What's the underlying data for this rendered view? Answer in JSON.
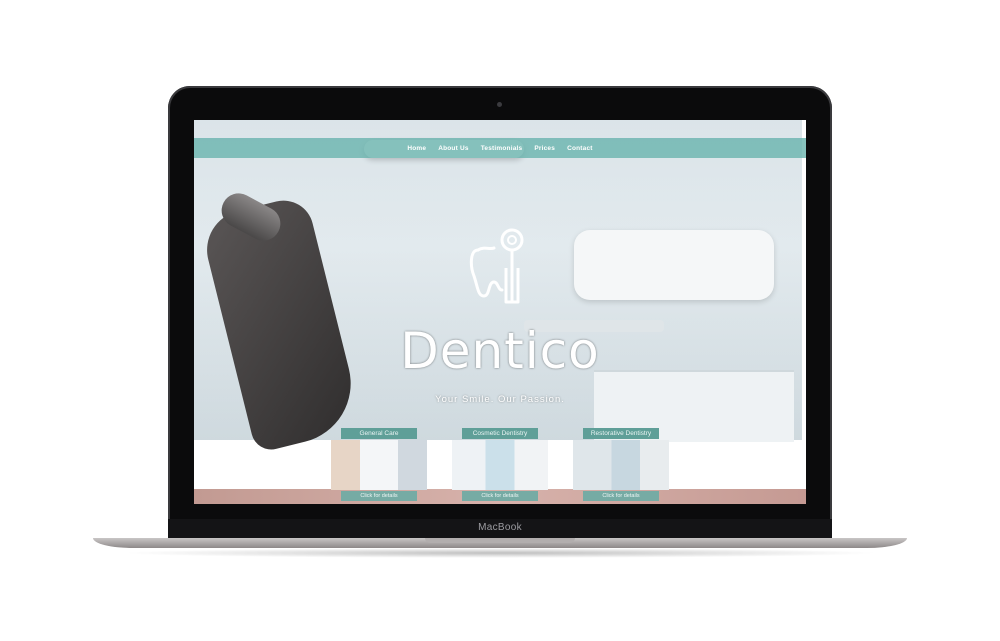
{
  "device": {
    "label": "MacBook"
  },
  "site": {
    "nav": [
      "Home",
      "About Us",
      "Testimonials",
      "Prices",
      "Contact"
    ],
    "brand": "Dentico",
    "tagline": "Your Smile. Our Passion.",
    "services": [
      {
        "title": "General Care",
        "action": "Click for details",
        "icon": "patient-photo"
      },
      {
        "title": "Cosmetic Dentistry",
        "action": "Click for details",
        "icon": "dentist-photo"
      },
      {
        "title": "Restorative Dentistry",
        "action": "Click for details",
        "icon": "treatment-photo"
      }
    ],
    "colors": {
      "accent": "#67b2ac",
      "label_bg": "#5f9f98",
      "footer_band": "#c9a39c"
    }
  }
}
